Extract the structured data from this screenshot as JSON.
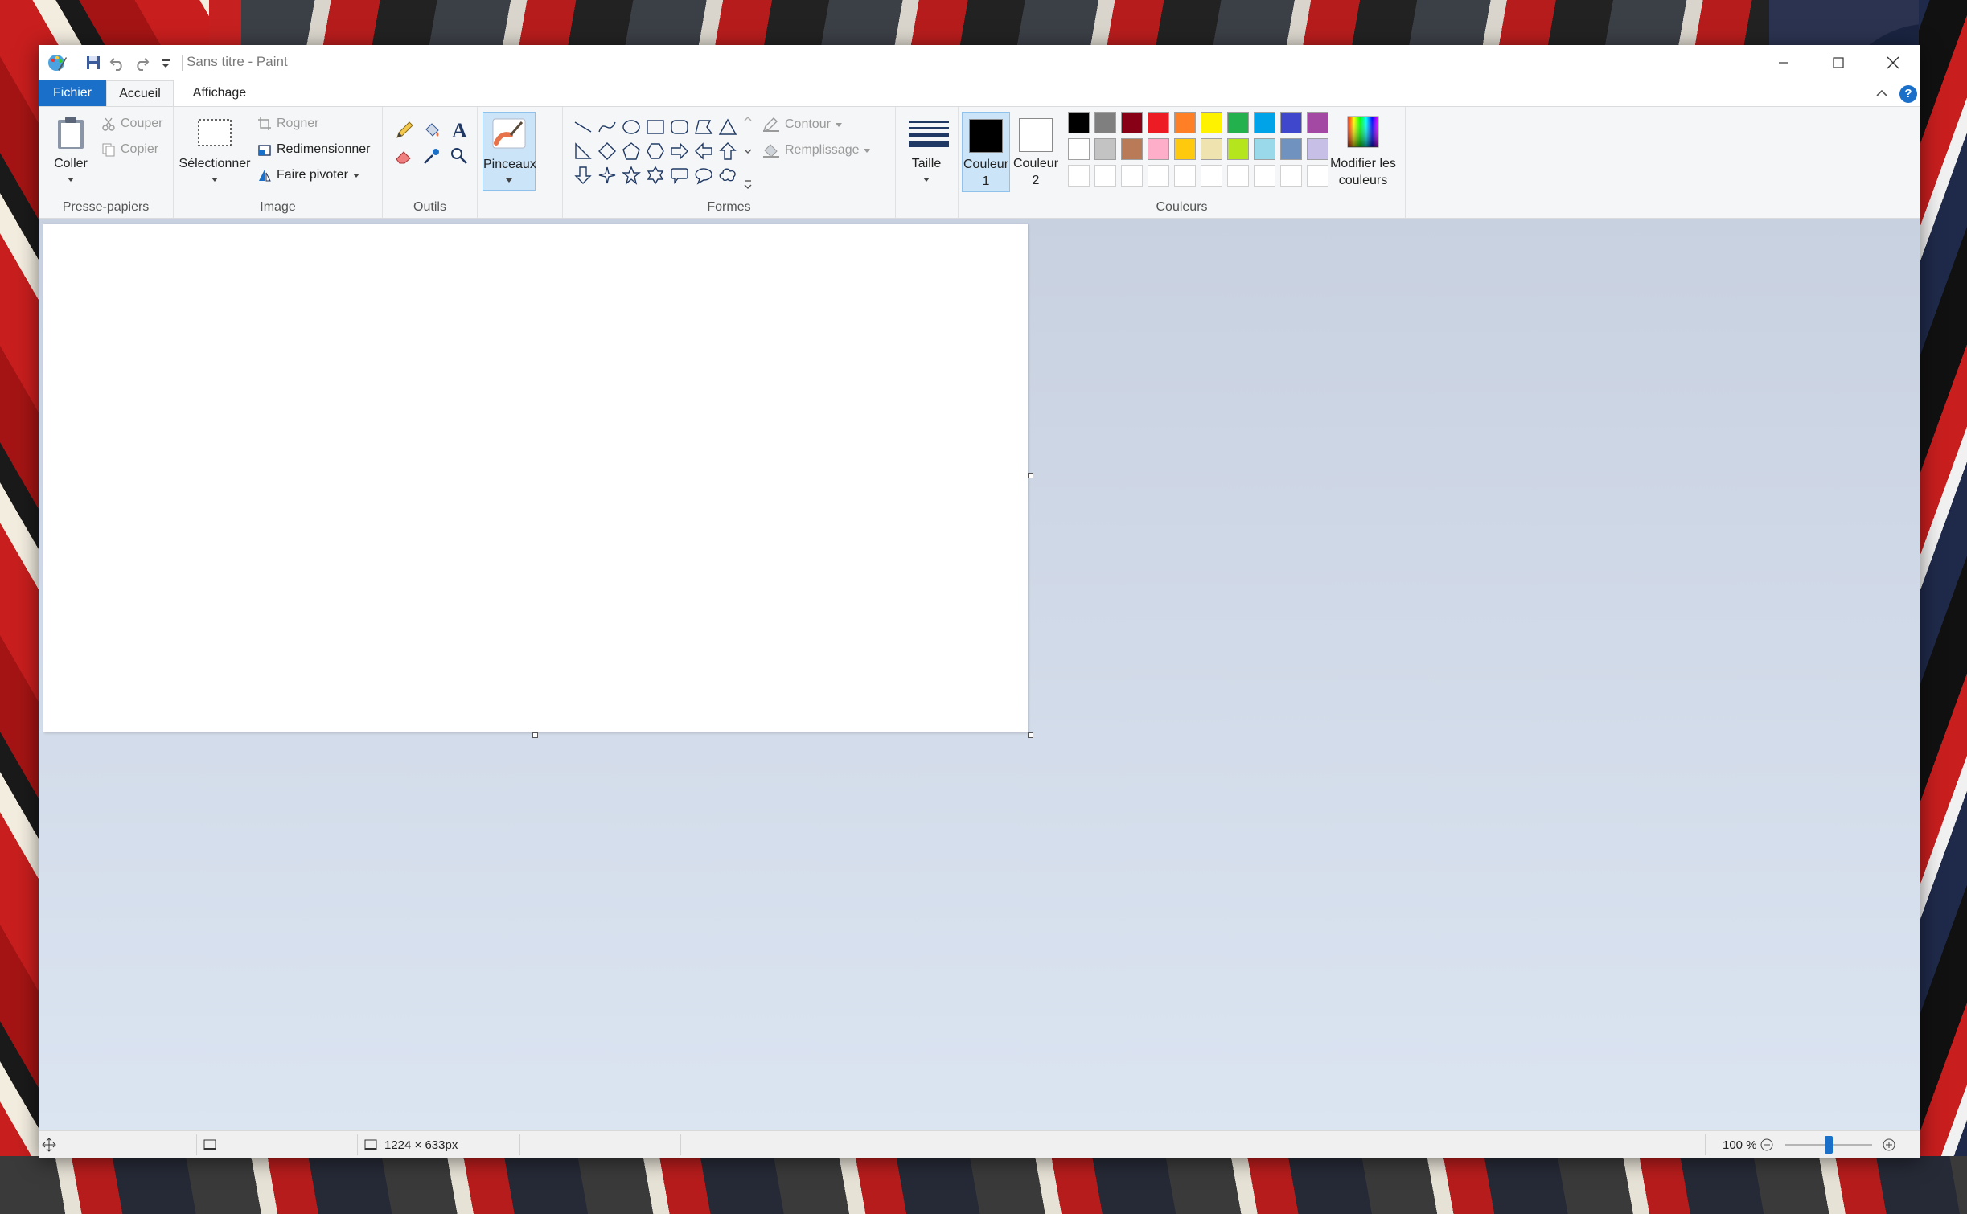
{
  "window": {
    "title": "Sans titre - Paint",
    "controls": {
      "minimize": "minimize-icon",
      "maximize": "maximize-icon",
      "close": "close-icon"
    }
  },
  "tabs": {
    "file": "Fichier",
    "home": "Accueil",
    "view": "Affichage"
  },
  "help": "?",
  "clipboard": {
    "paste": "Coller",
    "cut": "Couper",
    "copy": "Copier",
    "group": "Presse-papiers"
  },
  "image": {
    "select": "Sélectionner",
    "crop": "Rogner",
    "resize": "Redimensionner",
    "rotate": "Faire pivoter",
    "group": "Image"
  },
  "tools": {
    "group": "Outils"
  },
  "brushes": {
    "label": "Pinceaux"
  },
  "shapes": {
    "group": "Formes",
    "outline": "Contour",
    "fill": "Remplissage",
    "items": [
      "line",
      "curve",
      "oval",
      "rectangle",
      "rounded-rectangle",
      "polygon",
      "triangle",
      "right-triangle",
      "diamond",
      "pentagon",
      "hexagon",
      "right-arrow",
      "left-arrow",
      "up-arrow",
      "down-arrow",
      "four-point-star",
      "five-point-star",
      "six-point-star",
      "rounded-callout",
      "oval-callout",
      "cloud-callout"
    ]
  },
  "size": {
    "label": "Taille"
  },
  "colors": {
    "group": "Couleurs",
    "color1": {
      "label": "Couleur 1",
      "value": "#000000"
    },
    "color2": {
      "label": "Couleur 2",
      "value": "#ffffff"
    },
    "edit": "Modifier les couleurs",
    "palette_row1": [
      "#000000",
      "#7f7f7f",
      "#880015",
      "#ed1c24",
      "#ff7f27",
      "#fff200",
      "#22b14c",
      "#00a2e8",
      "#3f48cc",
      "#a349a4"
    ],
    "palette_row2": [
      "#ffffff",
      "#c3c3c3",
      "#b97a57",
      "#ffaec9",
      "#ffc90e",
      "#efe4b0",
      "#b5e61d",
      "#99d9ea",
      "#7092be",
      "#c8bfe7"
    ]
  },
  "status": {
    "canvas_size": "1224 × 633px",
    "zoom": "100 %",
    "zoom_fraction": 0.5
  }
}
